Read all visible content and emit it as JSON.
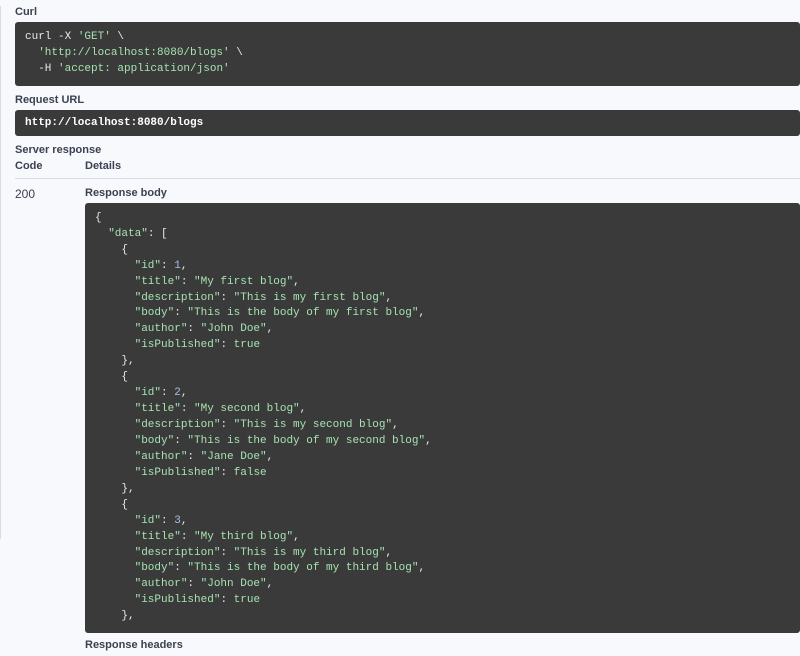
{
  "labels": {
    "curl": "Curl",
    "requestUrl": "Request URL",
    "serverResponse": "Server response",
    "code": "Code",
    "details": "Details",
    "responseBody": "Response body",
    "responseHeaders": "Response headers"
  },
  "curl": {
    "method": "GET",
    "url": "http://localhost:8080/blogs",
    "header": "accept: application/json"
  },
  "requestUrl": "http://localhost:8080/blogs",
  "statusCode": "200",
  "response": {
    "data": [
      {
        "id": 1,
        "title": "My first blog",
        "description": "This is my first blog",
        "body": "This is the body of my first blog",
        "author": "John Doe",
        "isPublished": true
      },
      {
        "id": 2,
        "title": "My second blog",
        "description": "This is my second blog",
        "body": "This is the body of my second blog",
        "author": "Jane Doe",
        "isPublished": false
      },
      {
        "id": 3,
        "title": "My third blog",
        "description": "This is my third blog",
        "body": "This is the body of my third blog",
        "author": "John Doe",
        "isPublished": true
      }
    ]
  }
}
